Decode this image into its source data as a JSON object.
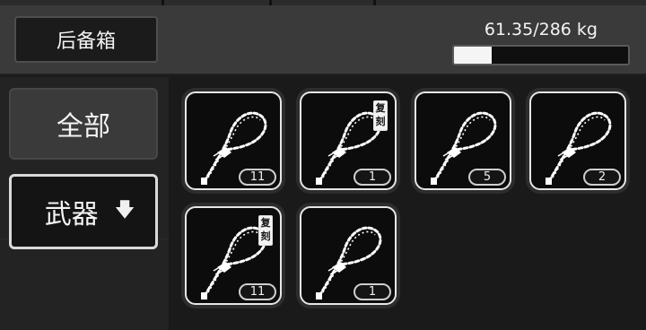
{
  "header": {
    "title": "后备箱",
    "weight_text": "61.35/286 kg",
    "weight_fraction": 0.2145
  },
  "sidebar": {
    "tabs": [
      {
        "label": "全部"
      },
      {
        "label": "武器",
        "arrow_icon": "down-arrow-icon"
      }
    ]
  },
  "inventory": {
    "items": [
      {
        "icon": "whip-icon",
        "count": "11",
        "badge": ""
      },
      {
        "icon": "whip-icon",
        "count": "1",
        "badge": "复刻"
      },
      {
        "icon": "whip-icon",
        "count": "5",
        "badge": ""
      },
      {
        "icon": "whip-icon",
        "count": "2",
        "badge": ""
      },
      {
        "icon": "whip-icon",
        "count": "11",
        "badge": "复刻"
      },
      {
        "icon": "whip-icon",
        "count": "1",
        "badge": ""
      }
    ]
  },
  "colors": {
    "header_bg": "#3a3a3a",
    "panel_bg": "#1a1a1a",
    "slot_border": "#e6e6e6",
    "bar_fill": "#f5f5f5"
  }
}
